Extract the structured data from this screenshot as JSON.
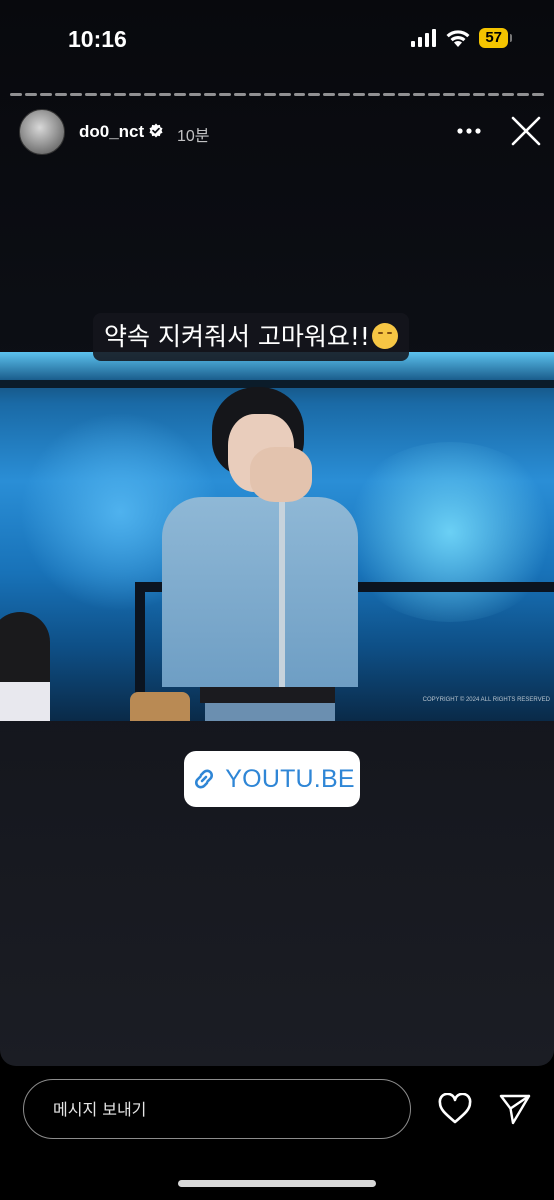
{
  "status_bar": {
    "time": "10:16",
    "battery": "57",
    "icons": [
      "signal-icon",
      "wifi-icon",
      "battery-icon"
    ]
  },
  "story": {
    "segments": 36,
    "username": "do0_nct",
    "time_ago": "10분",
    "caption": "약속 지켜줘서 고마워요!!",
    "caption_emoji": "smiling-face-emoji",
    "link_text": "YOUTU.BE",
    "photo_copyright": "COPYRIGHT © 2024 ALL RIGHTS RESERVED"
  },
  "composer": {
    "placeholder": "메시지 보내기"
  },
  "colors": {
    "accent_link": "#2f86d6",
    "battery": "#f4c400",
    "background": "#0c0e14"
  }
}
